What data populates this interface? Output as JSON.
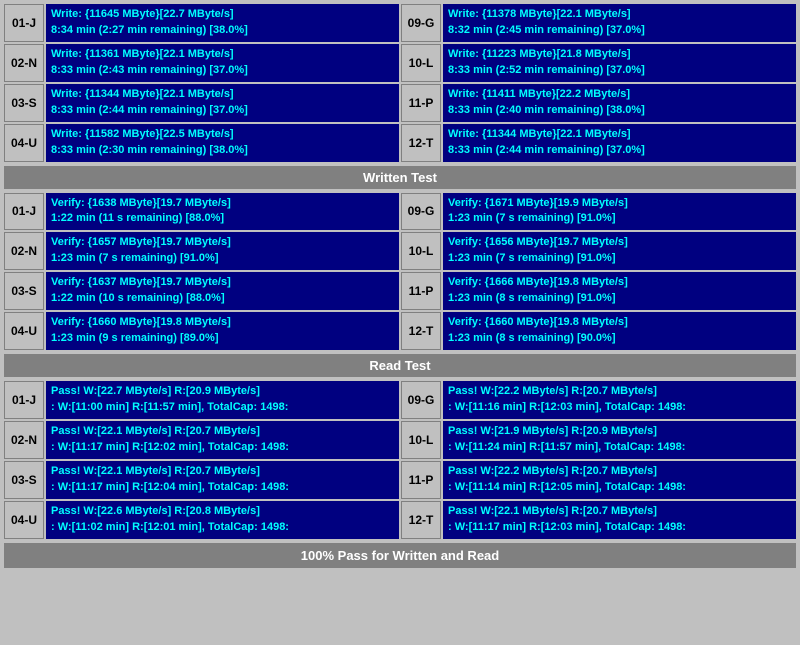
{
  "sections": {
    "write_test": {
      "label": "Written Test",
      "rows": [
        {
          "id_left": "01-J",
          "text_left_1": "Write: {11645 MByte}[22.7 MByte/s]",
          "text_left_2": "8:34 min (2:27 min remaining)  [38.0%]",
          "id_right": "09-G",
          "text_right_1": "Write: {11378 MByte}[22.1 MByte/s]",
          "text_right_2": "8:32 min (2:45 min remaining)  [37.0%]"
        },
        {
          "id_left": "02-N",
          "text_left_1": "Write: {11361 MByte}[22.1 MByte/s]",
          "text_left_2": "8:33 min (2:43 min remaining)  [37.0%]",
          "id_right": "10-L",
          "text_right_1": "Write: {11223 MByte}[21.8 MByte/s]",
          "text_right_2": "8:33 min (2:52 min remaining)  [37.0%]"
        },
        {
          "id_left": "03-S",
          "text_left_1": "Write: {11344 MByte}[22.1 MByte/s]",
          "text_left_2": "8:33 min (2:44 min remaining)  [37.0%]",
          "id_right": "11-P",
          "text_right_1": "Write: {11411 MByte}[22.2 MByte/s]",
          "text_right_2": "8:33 min (2:40 min remaining)  [38.0%]"
        },
        {
          "id_left": "04-U",
          "text_left_1": "Write: {11582 MByte}[22.5 MByte/s]",
          "text_left_2": "8:33 min (2:30 min remaining)  [38.0%]",
          "id_right": "12-T",
          "text_right_1": "Write: {11344 MByte}[22.1 MByte/s]",
          "text_right_2": "8:33 min (2:44 min remaining)  [37.0%]"
        }
      ]
    },
    "verify_test": {
      "label": "Written Test",
      "rows": [
        {
          "id_left": "01-J",
          "text_left_1": "Verify: {1638 MByte}[19.7 MByte/s]",
          "text_left_2": "1:22 min (11 s remaining)   [88.0%]",
          "id_right": "09-G",
          "text_right_1": "Verify: {1671 MByte}[19.9 MByte/s]",
          "text_right_2": "1:23 min (7 s remaining)   [91.0%]"
        },
        {
          "id_left": "02-N",
          "text_left_1": "Verify: {1657 MByte}[19.7 MByte/s]",
          "text_left_2": "1:23 min (7 s remaining)   [91.0%]",
          "id_right": "10-L",
          "text_right_1": "Verify: {1656 MByte}[19.7 MByte/s]",
          "text_right_2": "1:23 min (7 s remaining)   [91.0%]"
        },
        {
          "id_left": "03-S",
          "text_left_1": "Verify: {1637 MByte}[19.7 MByte/s]",
          "text_left_2": "1:22 min (10 s remaining)   [88.0%]",
          "id_right": "11-P",
          "text_right_1": "Verify: {1666 MByte}[19.8 MByte/s]",
          "text_right_2": "1:23 min (8 s remaining)   [91.0%]"
        },
        {
          "id_left": "04-U",
          "text_left_1": "Verify: {1660 MByte}[19.8 MByte/s]",
          "text_left_2": "1:23 min (9 s remaining)   [89.0%]",
          "id_right": "12-T",
          "text_right_1": "Verify: {1660 MByte}[19.8 MByte/s]",
          "text_right_2": "1:23 min (8 s remaining)   [90.0%]"
        }
      ]
    },
    "read_test": {
      "label": "Read Test",
      "rows": [
        {
          "id_left": "01-J",
          "text_left_1": "Pass! W:[22.7 MByte/s] R:[20.9 MByte/s]",
          "text_left_2": ": W:[11:00 min] R:[11:57 min], TotalCap: 1498:",
          "id_right": "09-G",
          "text_right_1": "Pass! W:[22.2 MByte/s] R:[20.7 MByte/s]",
          "text_right_2": ": W:[11:16 min] R:[12:03 min], TotalCap: 1498:"
        },
        {
          "id_left": "02-N",
          "text_left_1": "Pass! W:[22.1 MByte/s] R:[20.7 MByte/s]",
          "text_left_2": ": W:[11:17 min] R:[12:02 min], TotalCap: 1498:",
          "id_right": "10-L",
          "text_right_1": "Pass! W:[21.9 MByte/s] R:[20.9 MByte/s]",
          "text_right_2": ": W:[11:24 min] R:[11:57 min], TotalCap: 1498:"
        },
        {
          "id_left": "03-S",
          "text_left_1": "Pass! W:[22.1 MByte/s] R:[20.7 MByte/s]",
          "text_left_2": ": W:[11:17 min] R:[12:04 min], TotalCap: 1498:",
          "id_right": "11-P",
          "text_right_1": "Pass! W:[22.2 MByte/s] R:[20.7 MByte/s]",
          "text_right_2": ": W:[11:14 min] R:[12:05 min], TotalCap: 1498:"
        },
        {
          "id_left": "04-U",
          "text_left_1": "Pass! W:[22.6 MByte/s] R:[20.8 MByte/s]",
          "text_left_2": ": W:[11:02 min] R:[12:01 min], TotalCap: 1498:",
          "id_right": "12-T",
          "text_right_1": "Pass! W:[22.1 MByte/s] R:[20.7 MByte/s]",
          "text_right_2": ": W:[11:17 min] R:[12:03 min], TotalCap: 1498:"
        }
      ]
    }
  },
  "headers": {
    "written_test": "Written Test",
    "read_test": "Read Test",
    "bottom_status": "100% Pass for Written and Read"
  }
}
